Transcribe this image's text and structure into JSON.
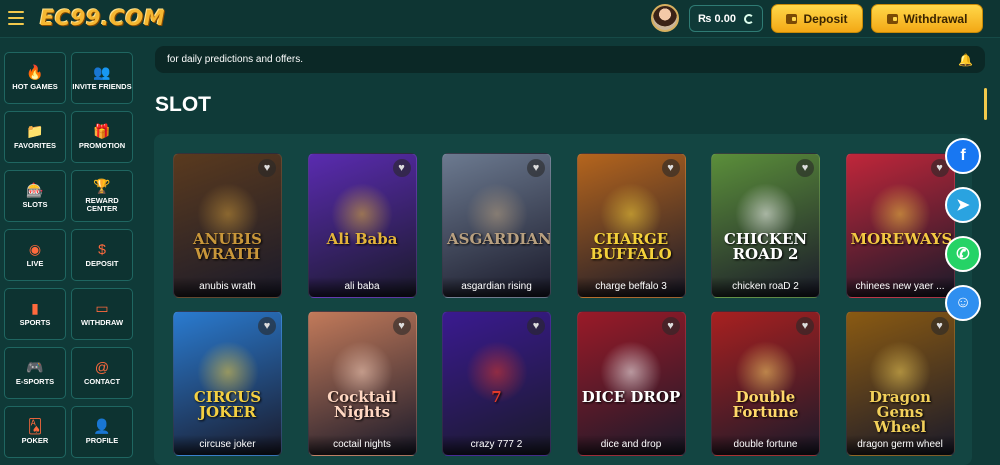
{
  "header": {
    "logo": "EC99.COM",
    "balance": "₨ 0.00",
    "deposit_label": "Deposit",
    "withdrawal_label": "Withdrawal"
  },
  "sidebar": {
    "items": [
      {
        "label": "HOT GAMES",
        "icon": "fire-icon",
        "glyph": "🔥"
      },
      {
        "label": "INVITE FRIENDS",
        "icon": "users-icon",
        "glyph": "👥"
      },
      {
        "label": "FAVORITES",
        "icon": "folder-icon",
        "glyph": "📁"
      },
      {
        "label": "PROMOTION",
        "icon": "gift-icon",
        "glyph": "🎁"
      },
      {
        "label": "SLOTS",
        "icon": "slot-machine-icon",
        "glyph": "🎰"
      },
      {
        "label": "REWARD CENTER",
        "icon": "trophy-icon",
        "glyph": "🏆"
      },
      {
        "label": "LIVE",
        "icon": "roulette-icon",
        "glyph": "◉"
      },
      {
        "label": "DEPOSIT",
        "icon": "dollar-icon",
        "glyph": "$"
      },
      {
        "label": "SPORTS",
        "icon": "phone-icon",
        "glyph": "▮"
      },
      {
        "label": "WITHDRAW",
        "icon": "monitor-icon",
        "glyph": "▭"
      },
      {
        "label": "E-SPORTS",
        "icon": "gamepad-icon",
        "glyph": "🎮"
      },
      {
        "label": "CONTACT",
        "icon": "at-icon",
        "glyph": "@"
      },
      {
        "label": "POKER",
        "icon": "poker-icon",
        "glyph": "🂡"
      },
      {
        "label": "PROFILE",
        "icon": "person-icon",
        "glyph": "👤"
      }
    ]
  },
  "notice": {
    "text": "for daily predictions and offers."
  },
  "section_title": "SLOT",
  "games": [
    {
      "name": "anubis wrath",
      "logo": "ANUBIS WRATH",
      "bg": "#5a3a1e",
      "accent": "#c9973a"
    },
    {
      "name": "ali baba",
      "logo": "Ali Baba",
      "bg": "#5a2bb0",
      "accent": "#e4b43a"
    },
    {
      "name": "asgardian rising",
      "logo": "ASGARDIAN",
      "bg": "#6c7a90",
      "accent": "#b8a080"
    },
    {
      "name": "charge beffalo 3",
      "logo": "CHARGE BUFFALO",
      "bg": "#b5651d",
      "accent": "#f4d13a"
    },
    {
      "name": "chicken roaD 2",
      "logo": "CHICKEN ROAD 2",
      "bg": "#5b8f3a",
      "accent": "#ffffff"
    },
    {
      "name": "chinees new yaer ...",
      "logo": "MOREWAYS",
      "bg": "#c0263a",
      "accent": "#f4c842"
    },
    {
      "name": "circuse joker",
      "logo": "CIRCUS JOKER",
      "bg": "#2a7bd0",
      "accent": "#f4d042"
    },
    {
      "name": "coctail nights",
      "logo": "Cocktail Nights",
      "bg": "#c27a5a",
      "accent": "#ffd7c2"
    },
    {
      "name": "crazy 777 2",
      "logo": "7",
      "bg": "#3a1a90",
      "accent": "#e23a2a"
    },
    {
      "name": "dice and drop",
      "logo": "DICE DROP",
      "bg": "#9a1a28",
      "accent": "#ffffff"
    },
    {
      "name": "double fortune",
      "logo": "Double Fortune",
      "bg": "#a82020",
      "accent": "#ffd86a"
    },
    {
      "name": "dragon germ wheel",
      "logo": "Dragon Gems Wheel",
      "bg": "#8a5a12",
      "accent": "#f2d05a"
    }
  ],
  "float_buttons": [
    {
      "label": "f",
      "icon": "facebook-icon",
      "color": "#1877f2"
    },
    {
      "label": "➤",
      "icon": "telegram-icon",
      "color": "#2aa3e0"
    },
    {
      "label": "✆",
      "icon": "whatsapp-icon",
      "color": "#25d366"
    },
    {
      "label": "☺",
      "icon": "support-icon",
      "color": "#2f8ff0"
    }
  ]
}
